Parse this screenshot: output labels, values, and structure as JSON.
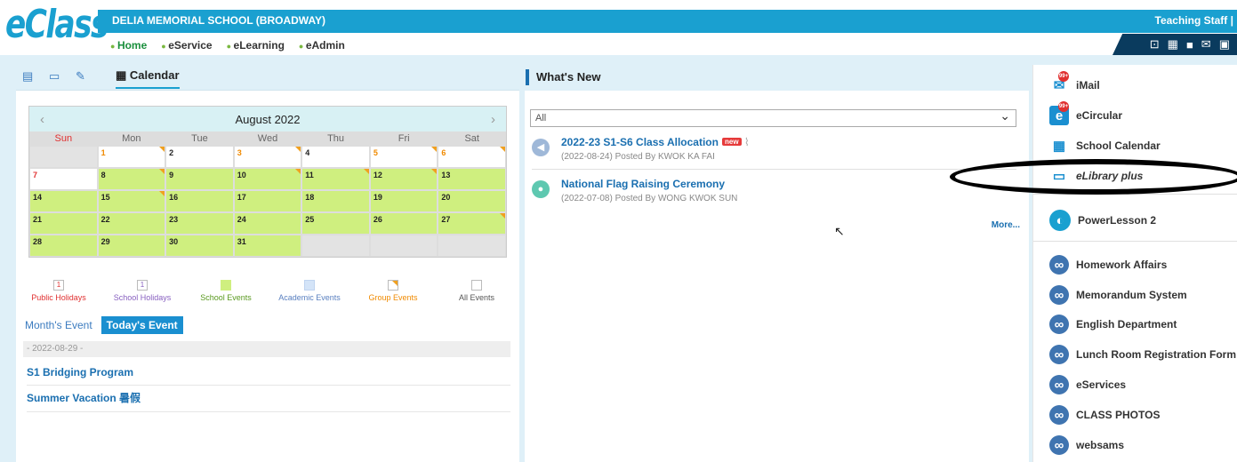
{
  "header": {
    "logo": "eClass",
    "school": "DELIA MEMORIAL SCHOOL (BROADWAY)",
    "user_role": "Teaching Staff |",
    "nav": [
      "Home",
      "eService",
      "eLearning",
      "eAdmin"
    ]
  },
  "left": {
    "tab_calendar": "Calendar",
    "calendar": {
      "month": "August 2022",
      "weekdays": [
        "Sun",
        "Mon",
        "Tue",
        "Wed",
        "Thu",
        "Fri",
        "Sat"
      ]
    },
    "legend": [
      "Public Holidays",
      "School Holidays",
      "School Events",
      "Academic Events",
      "Group Events",
      "All Events"
    ],
    "legend_count": "1",
    "month_event": "Month's Event",
    "today_event": "Today's Event",
    "date": "- 2022-08-29 -",
    "events": [
      "S1 Bridging Program",
      "Summer Vacation 暑假"
    ]
  },
  "main": {
    "title": "What's New",
    "filter": "All",
    "news": [
      {
        "title": "2022-23 S1-S6 Class Allocation",
        "badge": "new",
        "meta": "(2022-08-24) Posted By KWOK KA FAI"
      },
      {
        "title": "National Flag Raising Ceremony",
        "meta": "(2022-07-08) Posted By WONG KWOK SUN"
      }
    ],
    "more": "More..."
  },
  "right": {
    "badge": "99+",
    "items": [
      "iMail",
      "eCircular",
      "School Calendar",
      "eLibrary plus",
      "PowerLesson 2",
      "Homework Affairs",
      "Memorandum System",
      "English Department",
      "Lunch Room Registration Form",
      "eServices",
      "CLASS PHOTOS",
      "websams"
    ]
  },
  "colors": {
    "primary": "#1aa0d0",
    "school_event": "#cfef7f",
    "accent": "#e8521b"
  }
}
